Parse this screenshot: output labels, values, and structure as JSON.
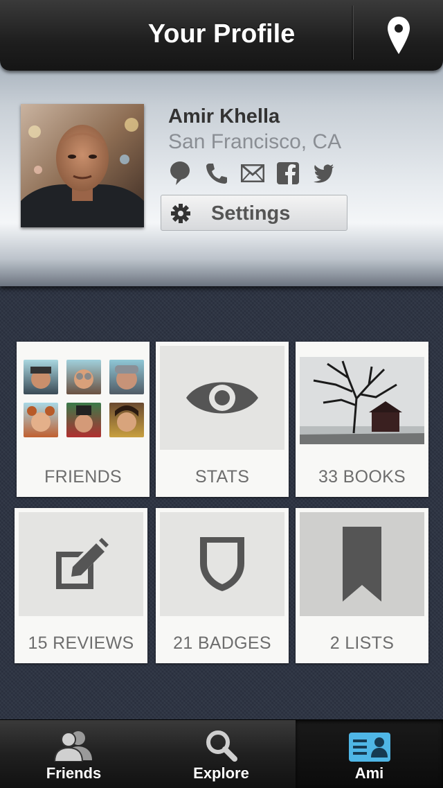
{
  "header": {
    "title": "Your Profile",
    "location_icon": "map-pin-icon"
  },
  "profile": {
    "name": "Amir Khella",
    "location": "San Francisco, CA",
    "contact_icons": [
      "chat-bubble-icon",
      "phone-icon",
      "mail-icon",
      "facebook-icon",
      "twitter-icon"
    ],
    "settings_label": "Settings"
  },
  "tiles": [
    {
      "id": "friends",
      "label": "FRIENDS"
    },
    {
      "id": "stats",
      "label": "STATS"
    },
    {
      "id": "books",
      "label": "33 BOOKS"
    },
    {
      "id": "reviews",
      "label": "15 REVIEWS"
    },
    {
      "id": "badges",
      "label": "21 BADGES"
    },
    {
      "id": "lists",
      "label": "2 LISTS"
    }
  ],
  "tabbar": {
    "tabs": [
      {
        "label": "Friends",
        "icon": "friends-icon"
      },
      {
        "label": "Explore",
        "icon": "search-icon"
      },
      {
        "label": "Ami",
        "icon": "profile-card-icon",
        "active": true
      }
    ]
  },
  "colors": {
    "accent_blue": "#4fb6e6",
    "tile_bg": "#f8f8f6",
    "icon_gray": "#5a5a5a"
  }
}
